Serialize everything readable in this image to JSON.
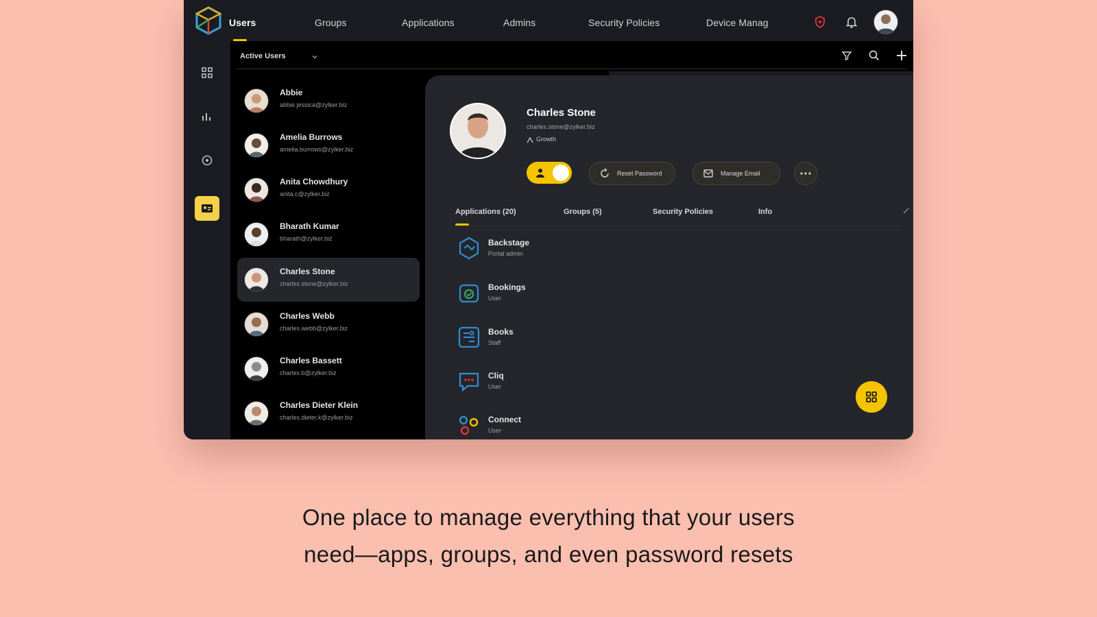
{
  "nav": {
    "tabs": [
      {
        "label": "Users",
        "active": true
      },
      {
        "label": "Groups"
      },
      {
        "label": "Applications"
      },
      {
        "label": "Admins"
      },
      {
        "label": "Security Policies"
      },
      {
        "label": "Device Manag"
      }
    ],
    "icons": [
      "alert-shield-icon",
      "bell-icon",
      "profile-avatar"
    ]
  },
  "sidebar": {
    "icons": [
      "dashboard-icon",
      "reports-icon",
      "security-icon",
      "directory-icon"
    ],
    "active_index": 3
  },
  "list_header": {
    "filter_label": "Active Users",
    "actions": [
      "filter-icon",
      "search-icon",
      "add-icon"
    ]
  },
  "users": [
    {
      "name": "Abbie",
      "email": "abbie.jessica@zylker.biz"
    },
    {
      "name": "Amelia Burrows",
      "email": "amelia.burrows@zylker.biz"
    },
    {
      "name": "Anita Chowdhury",
      "email": "anita.c@zylker.biz"
    },
    {
      "name": "Bharath Kumar",
      "email": "bharath@zylker.biz"
    },
    {
      "name": "Charles Stone",
      "email": "charles.stone@zylker.biz",
      "selected": true
    },
    {
      "name": "Charles Webb",
      "email": "charles.webb@zylker.biz"
    },
    {
      "name": "Charles Bassett",
      "email": "charles.b@zylker.biz"
    },
    {
      "name": "Charles Dieter Klein",
      "email": "charles.dieter.k@zylker.biz"
    }
  ],
  "profile": {
    "name": "Charles Stone",
    "email": "charles.stone@zylker.biz",
    "role": "Growth",
    "status_toggle": "on",
    "actions": {
      "reset_password": "Reset Password",
      "manage_email": "Manage Email"
    }
  },
  "detail_tabs": [
    {
      "label": "Applications (20)",
      "active": true
    },
    {
      "label": "Groups (5)"
    },
    {
      "label": "Security Policies"
    },
    {
      "label": "Info"
    }
  ],
  "applications": [
    {
      "name": "Backstage",
      "role": "Portal admin",
      "icon": "backstage-icon"
    },
    {
      "name": "Bookings",
      "role": "User",
      "icon": "bookings-icon"
    },
    {
      "name": "Books",
      "role": "Staff",
      "icon": "books-icon"
    },
    {
      "name": "Cliq",
      "role": "User",
      "icon": "cliq-icon"
    },
    {
      "name": "Connect",
      "role": "User",
      "icon": "connect-icon"
    }
  ],
  "colors": {
    "accent": "#f5c400",
    "background": "#fbbfb0",
    "panel": "#24262c",
    "frame": "#1b1c21"
  },
  "caption": {
    "line1": "One place to manage everything that your users",
    "line2": "need—apps, groups, and even password resets"
  }
}
